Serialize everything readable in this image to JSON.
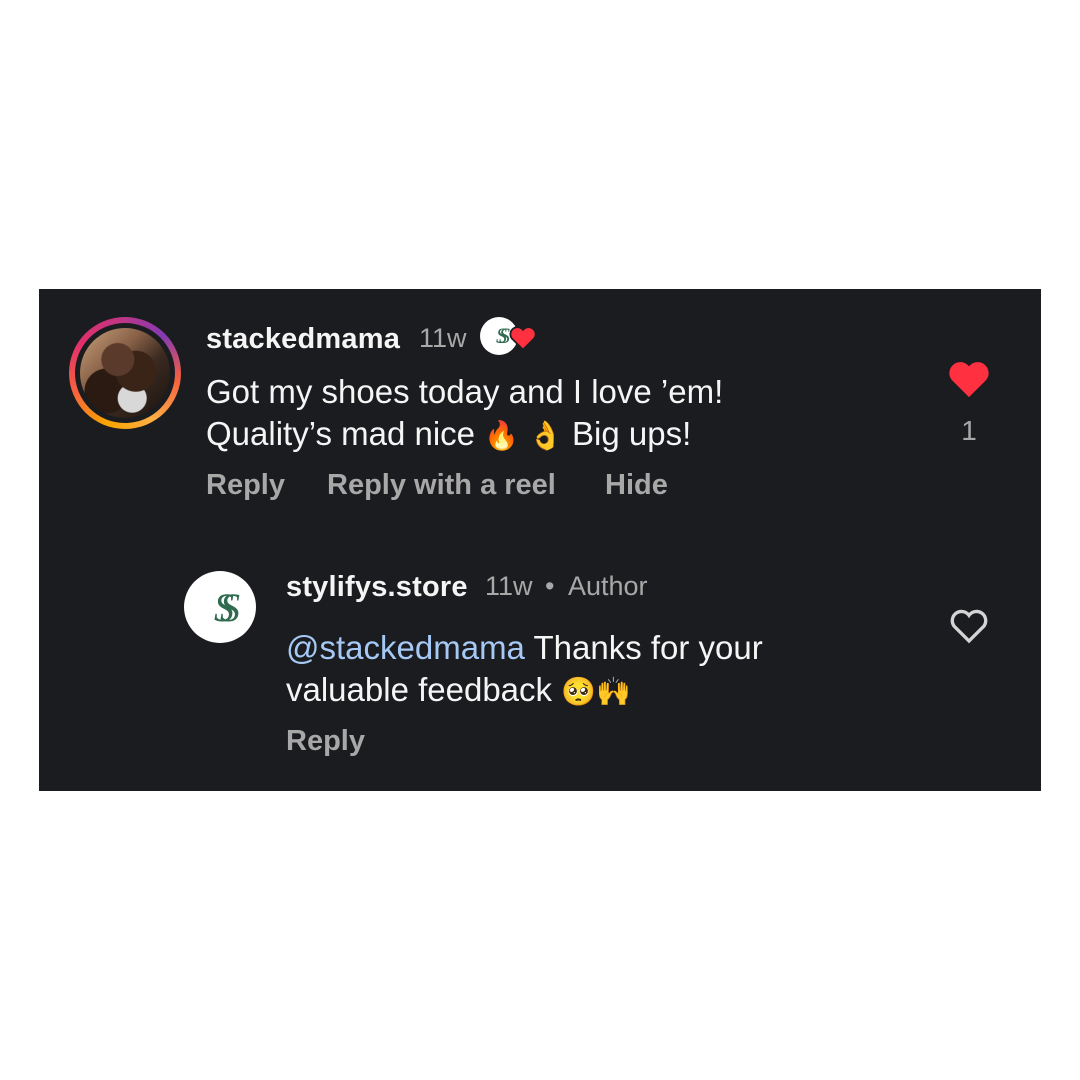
{
  "comments": [
    {
      "username": "stackedmama",
      "time": "11w",
      "line1": "Got my shoes today and I love ’em!",
      "line2_prefix": "Quality’s mad nice",
      "line2_emojis": "🔥 👌",
      "line2_suffix": "Big ups!",
      "actions": {
        "reply": "Reply",
        "reply_reel": "Reply with a reel",
        "hide": "Hide"
      },
      "likes": "1",
      "liked": true,
      "avatar": "user-photo",
      "badge": "creator-liked-badge"
    },
    {
      "username": "stylifys.store",
      "time": "11w",
      "separator": "•",
      "role": "Author",
      "mention": "@stackedmama",
      "line1_rest": " Thanks for your",
      "line2": "valuable feedback",
      "line2_emojis": "🥺🙌",
      "actions": {
        "reply": "Reply"
      },
      "liked": false,
      "avatar": "store-logo"
    }
  ],
  "brand": {
    "logo_text": "SS",
    "logo_color": "#2f6b4f"
  },
  "colors": {
    "background": "#1b1c1f",
    "like_red": "#ff3040",
    "muted": "#a8a8a8",
    "mention": "#a5c8f4"
  }
}
